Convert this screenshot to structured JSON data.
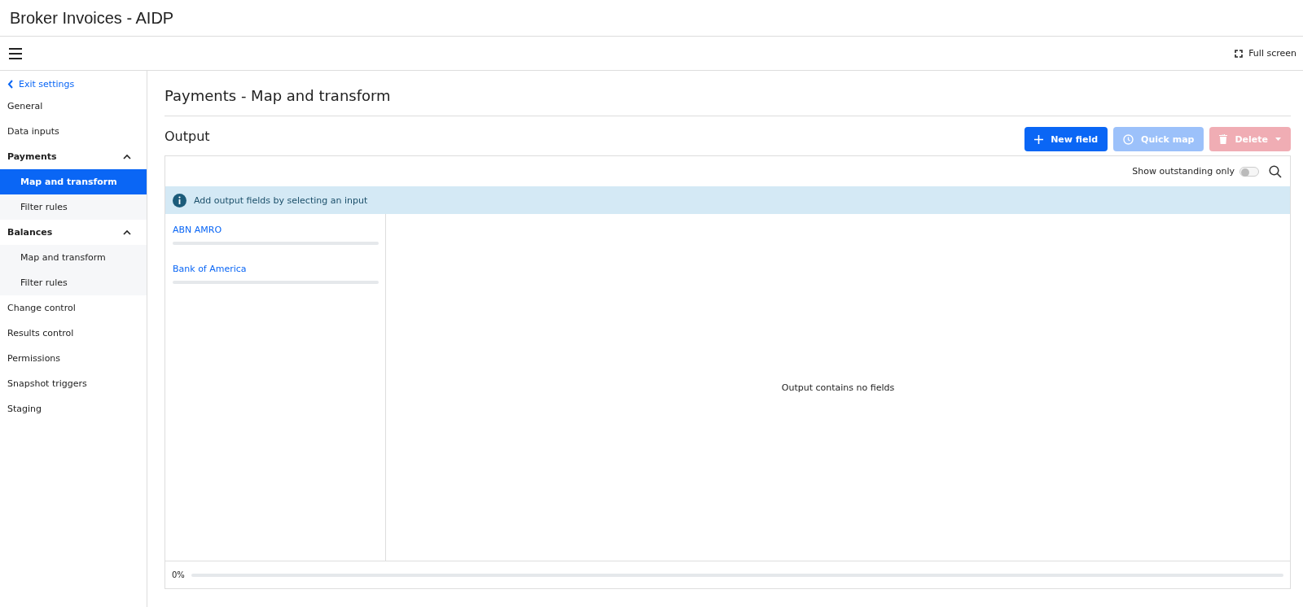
{
  "app_title": "Broker Invoices - AIDP",
  "toolbar": {
    "fullscreen_label": "Full screen"
  },
  "sidebar": {
    "back_link": "Exit settings",
    "items": [
      {
        "label": "General",
        "kind": "item",
        "selected": false
      },
      {
        "label": "Data inputs",
        "kind": "item",
        "selected": false
      },
      {
        "label": "Payments",
        "kind": "group",
        "expanded": true,
        "children": [
          {
            "label": "Map and transform",
            "selected": true
          },
          {
            "label": "Filter rules",
            "selected": false
          }
        ]
      },
      {
        "label": "Balances",
        "kind": "group",
        "expanded": true,
        "children": [
          {
            "label": "Map and transform",
            "selected": false
          },
          {
            "label": "Filter rules",
            "selected": false
          }
        ]
      },
      {
        "label": "Change control",
        "kind": "item",
        "selected": false
      },
      {
        "label": "Results control",
        "kind": "item",
        "selected": false
      },
      {
        "label": "Permissions",
        "kind": "item",
        "selected": false
      },
      {
        "label": "Snapshot triggers",
        "kind": "item",
        "selected": false
      },
      {
        "label": "Staging",
        "kind": "item",
        "selected": false
      }
    ]
  },
  "page_title": "Payments - Map and transform",
  "section_title": "Output",
  "buttons": [
    {
      "label": "New field",
      "kind": "primary",
      "disabled": false
    },
    {
      "label": "Quick map",
      "kind": "secondary",
      "disabled": true
    },
    {
      "label": "Delete",
      "kind": "danger",
      "disabled": true
    }
  ],
  "filter": {
    "label": "Show outstanding only",
    "on": false
  },
  "info_banner": "Add output fields by selecting an input",
  "inputs": [
    {
      "name": "ABN AMRO"
    },
    {
      "name": "Bank of America"
    }
  ],
  "empty_message": "Output contains no fields",
  "progress": {
    "reading": "0%"
  }
}
